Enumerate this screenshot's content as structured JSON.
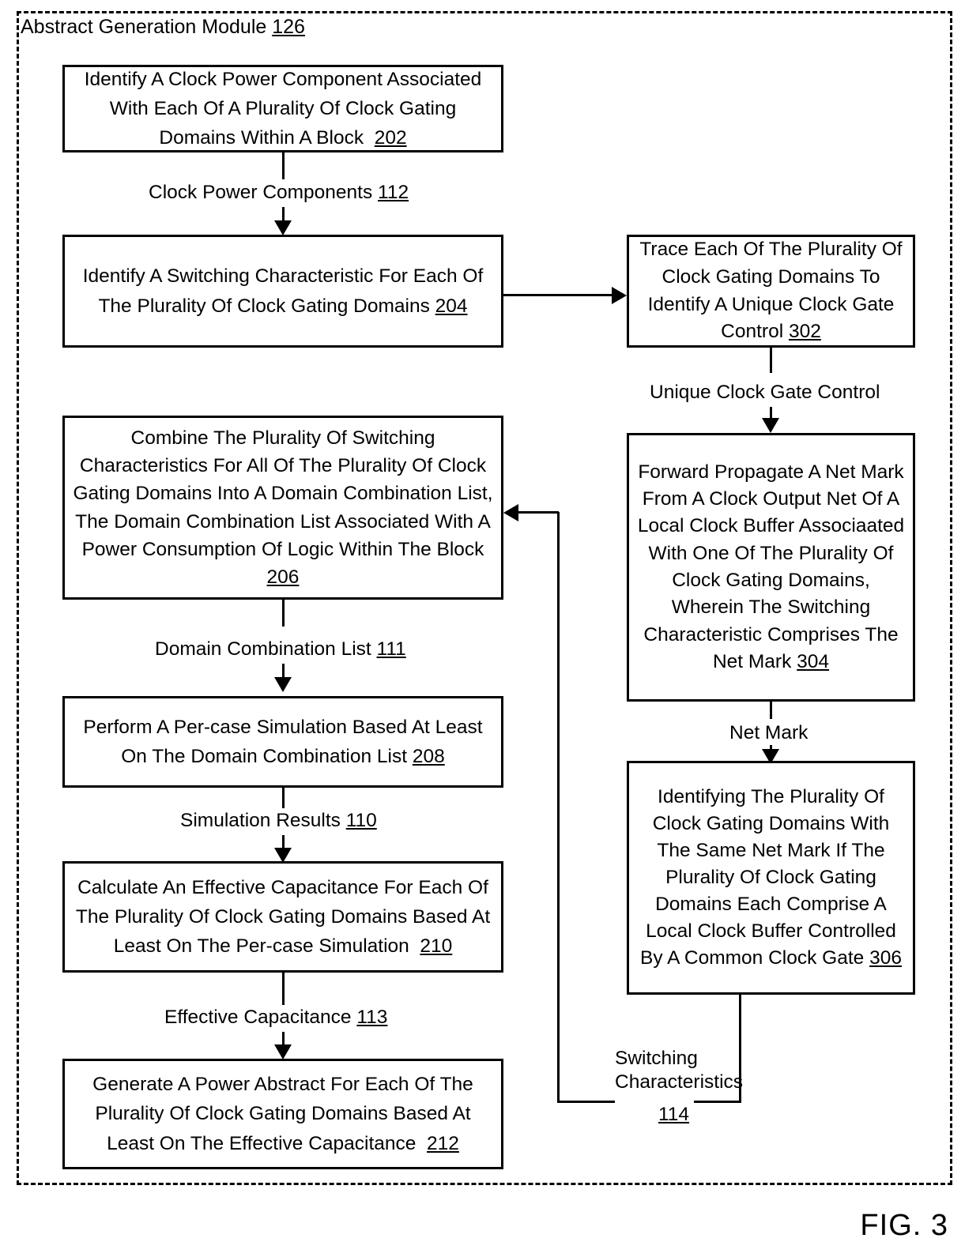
{
  "figure": {
    "caption": "FIG. 3",
    "module_title_text": "Abstract Generation Module",
    "module_title_ref": "126"
  },
  "boxes": {
    "b202": {
      "line1": "Identify A Clock Power Component Associated",
      "line2": "With Each Of A Plurality Of Clock Gating",
      "line3": "Domains Within A Block",
      "ref": "202"
    },
    "b204": {
      "line1": "Identify A Switching Characteristic For Each Of",
      "line2": "The Plurality Of Clock Gating Domains",
      "ref": "204"
    },
    "b206": {
      "line1": "Combine The Plurality Of Switching",
      "line2": "Characteristics For All Of The Plurality Of Clock",
      "line3": "Gating Domains Into A Domain Combination List,",
      "line4": "The Domain Combination List Associated With A",
      "line5": "Power Consumption Of Logic Within The Block",
      "ref": "206"
    },
    "b208": {
      "line1": "Perform A Per-case Simulation Based At Least",
      "line2": "On The Domain Combination List",
      "ref": "208"
    },
    "b210": {
      "line1": "Calculate An Effective Capacitance For Each Of",
      "line2": "The Plurality Of Clock Gating Domains Based At",
      "line3": "Least On The Per-case Simulation",
      "ref": "210"
    },
    "b212": {
      "line1": "Generate A Power Abstract For Each Of The",
      "line2": "Plurality Of Clock Gating Domains Based At",
      "line3": "Least On The Effective Capacitance",
      "ref": "212"
    },
    "b302": {
      "line1": "Trace Each Of The Plurality Of",
      "line2": "Clock Gating Domains To",
      "line3": "Identify A Unique Clock Gate",
      "line4": "Control",
      "ref": "302"
    },
    "b304": {
      "line1": "Forward Propagate A Net Mark",
      "line2": "From A Clock Output Net Of A",
      "line3": "Local Clock Buffer Associaated",
      "line4": "With One Of The Plurality Of",
      "line5": "Clock Gating Domains,",
      "line6": "Wherein The Switching",
      "line7": "Characteristic Comprises The",
      "line8": "Net Mark",
      "ref": "304"
    },
    "b306": {
      "line1": "Identifying The Plurality Of",
      "line2": "Clock Gating Domains With",
      "line3": "The Same Net Mark If The",
      "line4": "Plurality Of Clock Gating",
      "line5": "Domains Each Comprise A",
      "line6": "Local Clock Buffer Controlled",
      "line7": "By A Common Clock Gate",
      "ref": "306"
    }
  },
  "edge_labels": {
    "clock_power_components": {
      "text": "Clock Power Components",
      "ref": "112"
    },
    "domain_combination_list": {
      "text": "Domain Combination List",
      "ref": "111"
    },
    "simulation_results": {
      "text": "Simulation Results",
      "ref": "110"
    },
    "effective_capacitance": {
      "text": "Effective Capacitance",
      "ref": "113"
    },
    "unique_clock_gate_control": {
      "text": "Unique Clock Gate Control",
      "ref": ""
    },
    "net_mark": {
      "text": "Net Mark",
      "ref": ""
    },
    "switching_characteristics_line1": {
      "text": "Switching"
    },
    "switching_characteristics_line2": {
      "text": "Characteristics"
    },
    "switching_characteristics_ref": {
      "text": "114"
    }
  },
  "colors": {
    "stroke": "#000000",
    "background": "#ffffff"
  }
}
